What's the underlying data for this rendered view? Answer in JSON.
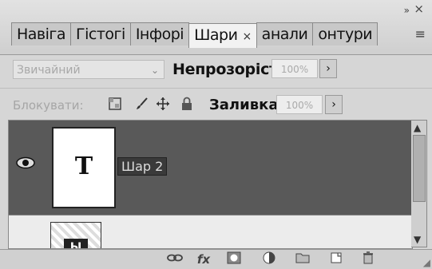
{
  "tabs": [
    {
      "label": "Навіга"
    },
    {
      "label": "Гістогі"
    },
    {
      "label": "Інфорі"
    },
    {
      "label": "Шари",
      "close": "×",
      "active": true
    },
    {
      "label": "анали"
    },
    {
      "label": "онтури"
    }
  ],
  "window": {
    "collapse_icon": "»",
    "close_icon": "×",
    "menu_icon": "≡"
  },
  "blend_mode": {
    "value": "Звичайний",
    "arrow": "⌄"
  },
  "opacity": {
    "label": "Непрозорість:",
    "value": "100%",
    "arrow": "›"
  },
  "lock": {
    "label": "Блокувати:",
    "icons": [
      "transparent-pixels-lock-icon",
      "brush-icon",
      "move-icon",
      "lock-all-icon"
    ]
  },
  "fill": {
    "label": "Заливка:",
    "value": "100%",
    "arrow": "›"
  },
  "layers": [
    {
      "name": "Шар 2",
      "thumb_letter": "T",
      "selected": true,
      "visible": true
    },
    {
      "name": "",
      "thumb_letter": "Ы",
      "selected": false
    }
  ],
  "scrollbar": {
    "up_icon": "▲",
    "down_icon": "▼"
  },
  "bottom_icons": [
    "link-icon",
    "fx-icon",
    "mask-icon",
    "adjustment-icon",
    "folder-icon",
    "new-layer-icon",
    "trash-icon"
  ],
  "colors": {
    "selected_row": "#595959",
    "panel_bg": "#d6d6d6"
  }
}
